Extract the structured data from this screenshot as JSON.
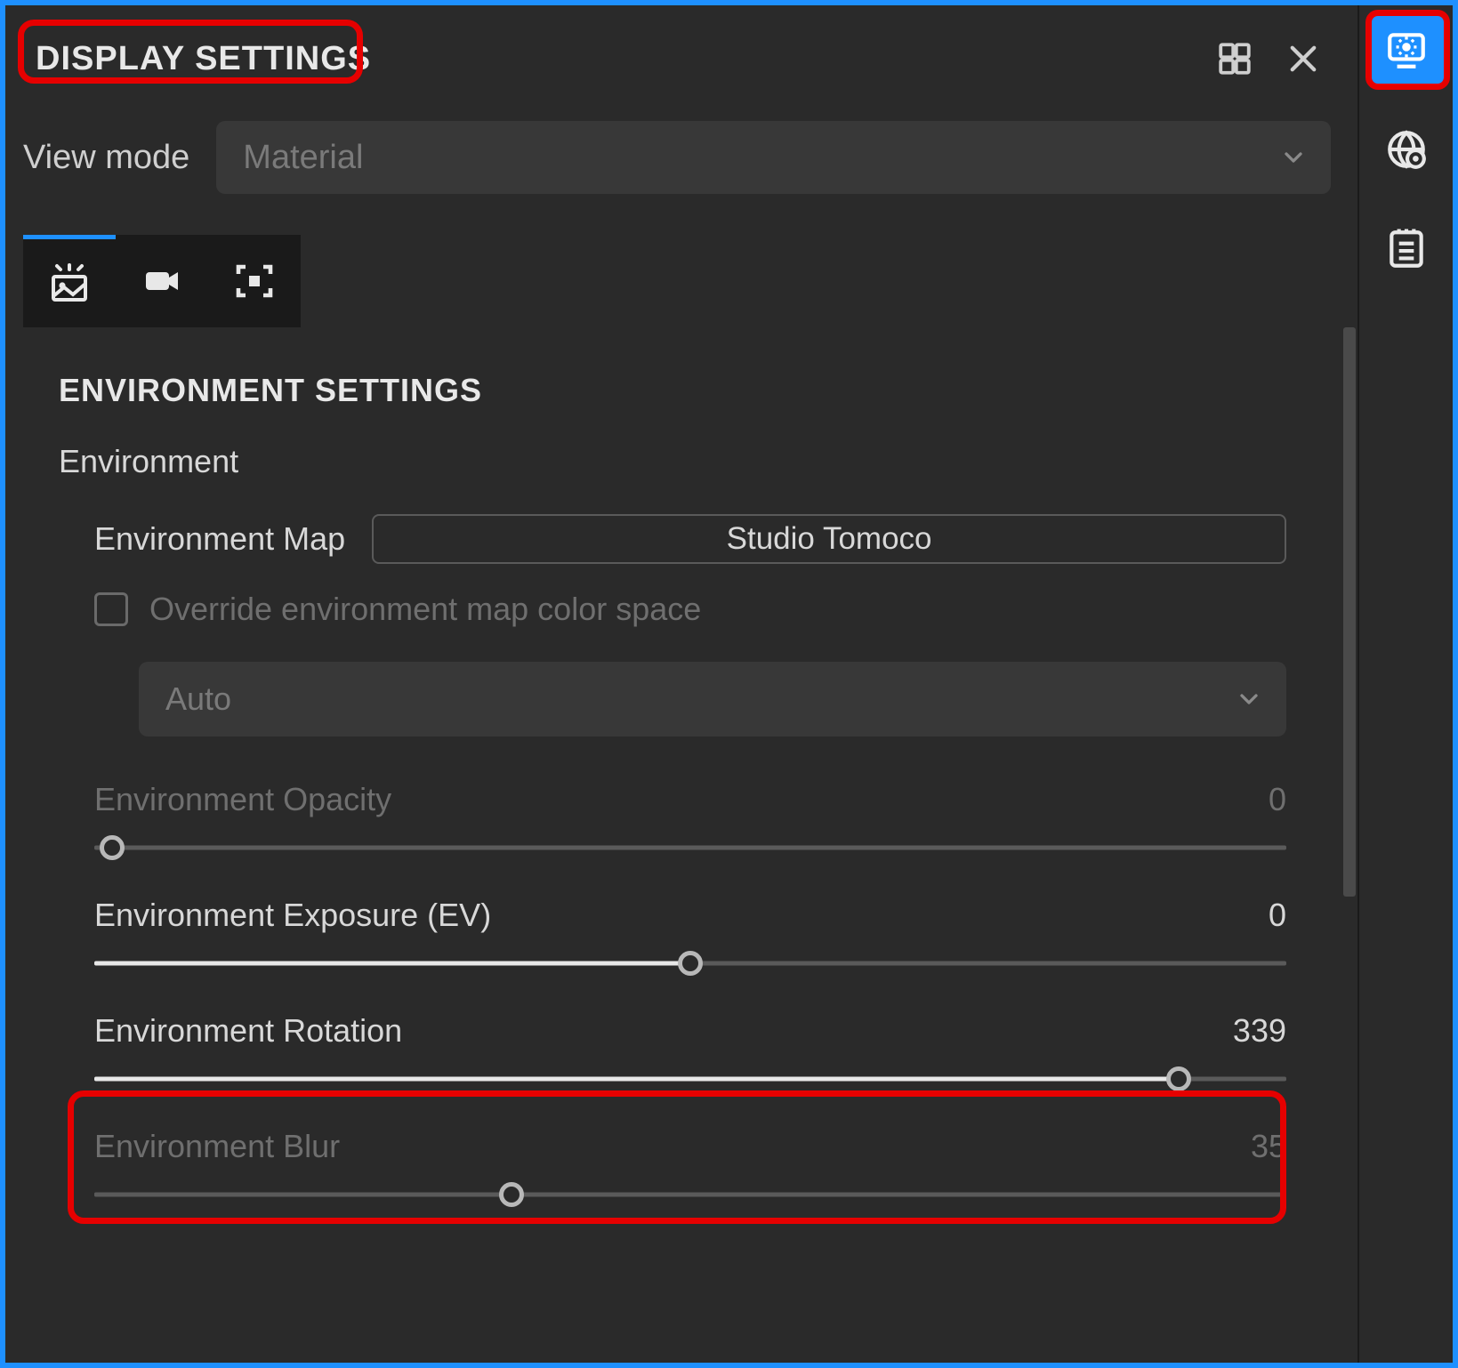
{
  "panel": {
    "title": "DISPLAY SETTINGS"
  },
  "view_mode": {
    "label": "View mode",
    "value": "Material"
  },
  "section": {
    "title": "ENVIRONMENT SETTINGS",
    "subtitle": "Environment"
  },
  "env_map": {
    "label": "Environment Map",
    "value": "Studio Tomoco"
  },
  "override": {
    "label": "Override environment map color space",
    "checked": false
  },
  "color_space_select": {
    "value": "Auto"
  },
  "sliders": {
    "opacity": {
      "label": "Environment Opacity",
      "value": "0",
      "percent": 0,
      "enabled": false
    },
    "exposure": {
      "label": "Environment Exposure (EV)",
      "value": "0",
      "percent": 50,
      "enabled": true
    },
    "rotation": {
      "label": "Environment Rotation",
      "value": "339",
      "percent": 91,
      "enabled": true
    },
    "blur": {
      "label": "Environment Blur",
      "value": "35",
      "percent": 35,
      "enabled": false
    }
  },
  "sidebar": {
    "items": [
      "display-settings",
      "world-settings",
      "notes"
    ]
  }
}
